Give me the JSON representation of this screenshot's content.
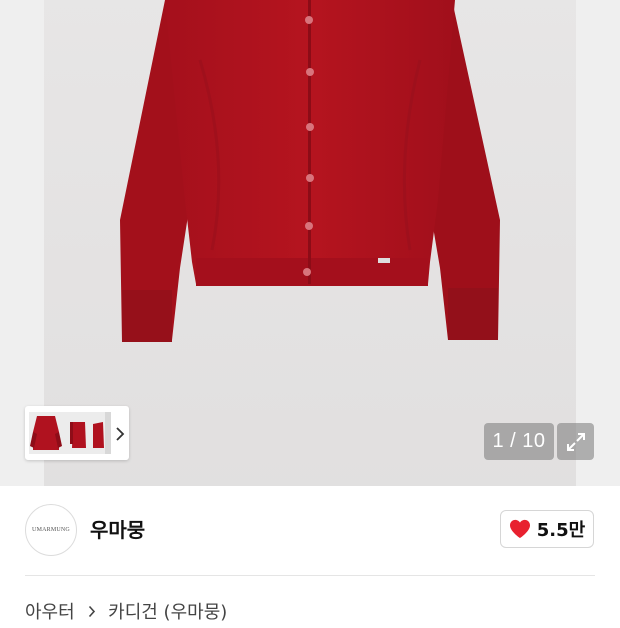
{
  "gallery": {
    "counter": "1 / 10",
    "thumbnail_colors": {
      "garment": "#b0121f",
      "garment_shadow": "#8e0d18",
      "background": "#ececec"
    }
  },
  "store": {
    "logo_text": "UMARMUNG",
    "name": "우마뭉",
    "like_count": "5.5만",
    "like_color": "#e8212f"
  },
  "breadcrumb": {
    "items": [
      "아우터",
      "카디건 (우마뭉)"
    ]
  },
  "icons": {
    "thumb_next": "chevron-right-icon",
    "expand": "expand-arrows-icon",
    "like": "heart-icon"
  }
}
